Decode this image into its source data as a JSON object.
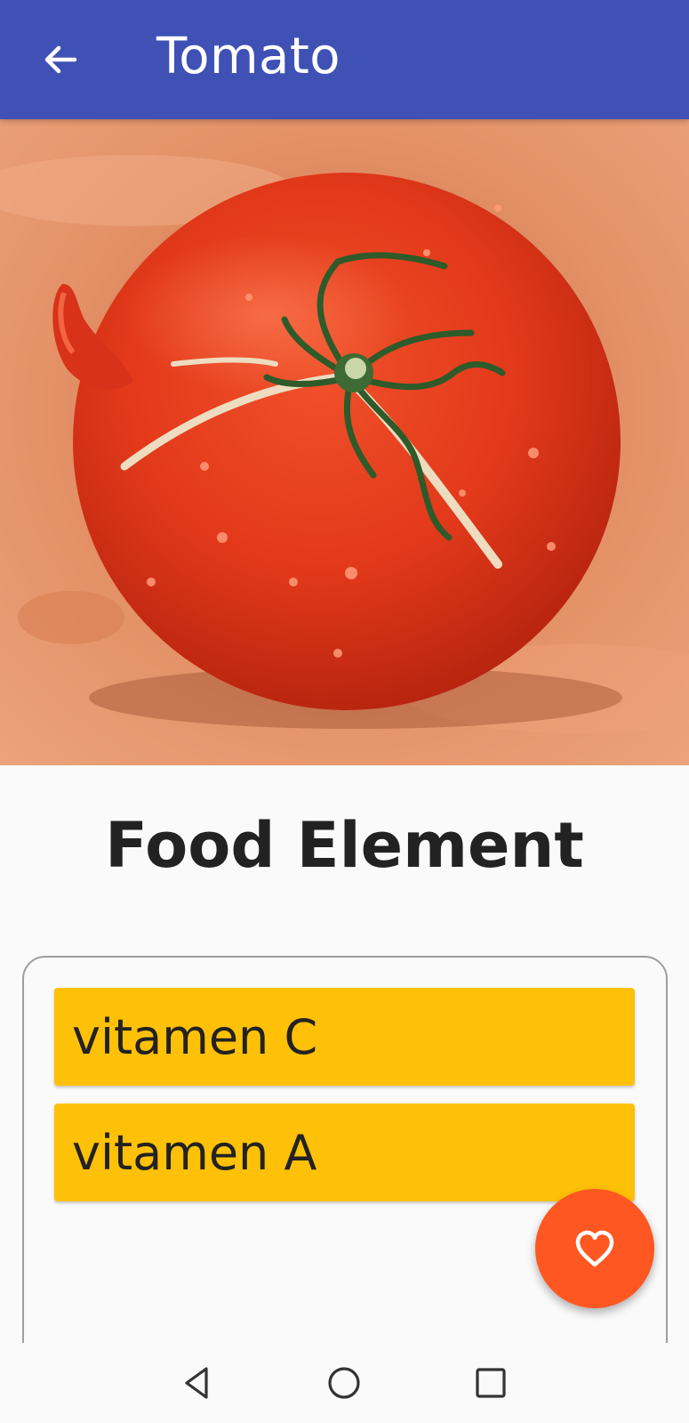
{
  "app_bar": {
    "title": "Tomato",
    "back_icon": "arrow-back-icon",
    "background_color": "#3f51b5"
  },
  "hero": {
    "image_subject": "tomato"
  },
  "section": {
    "heading": "Food Element"
  },
  "elements": [
    {
      "label": "vitamen C"
    },
    {
      "label": "vitamen A"
    }
  ],
  "element_color": "#ffc107",
  "fab": {
    "icon": "heart-outline-icon",
    "color": "#ff5722"
  },
  "system_nav": {
    "back_icon": "triangle-back-icon",
    "home_icon": "circle-home-icon",
    "recents_icon": "square-recents-icon"
  }
}
